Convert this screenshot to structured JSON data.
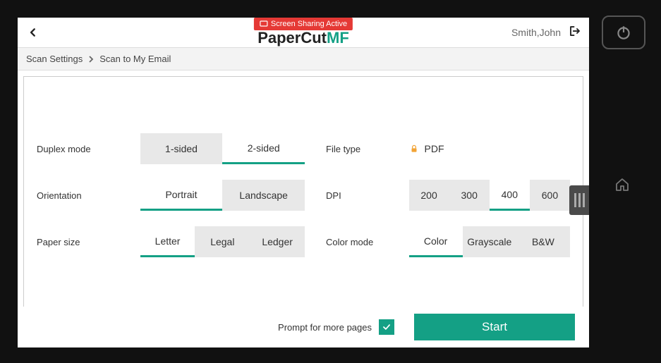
{
  "header": {
    "screen_sharing_badge": "Screen Sharing Active",
    "logo_main": "PaperCut",
    "logo_suffix": "MF",
    "username": "Smith,John"
  },
  "breadcrumb": {
    "root": "Scan Settings",
    "current": "Scan to My Email"
  },
  "settings": {
    "duplex": {
      "label": "Duplex mode",
      "options": [
        "1-sided",
        "2-sided"
      ],
      "selected": "2-sided"
    },
    "orientation": {
      "label": "Orientation",
      "options": [
        "Portrait",
        "Landscape"
      ],
      "selected": "Portrait"
    },
    "paper_size": {
      "label": "Paper size",
      "options": [
        "Letter",
        "Legal",
        "Ledger"
      ],
      "selected": "Letter"
    },
    "file_type": {
      "label": "File type",
      "value": "PDF",
      "locked": true
    },
    "dpi": {
      "label": "DPI",
      "options": [
        "200",
        "300",
        "400",
        "600"
      ],
      "selected": "400"
    },
    "color_mode": {
      "label": "Color mode",
      "options": [
        "Color",
        "Grayscale",
        "B&W"
      ],
      "selected": "Color"
    }
  },
  "footer": {
    "prompt_label": "Prompt for more pages",
    "prompt_checked": true,
    "start_label": "Start"
  },
  "colors": {
    "accent": "#14a085"
  }
}
